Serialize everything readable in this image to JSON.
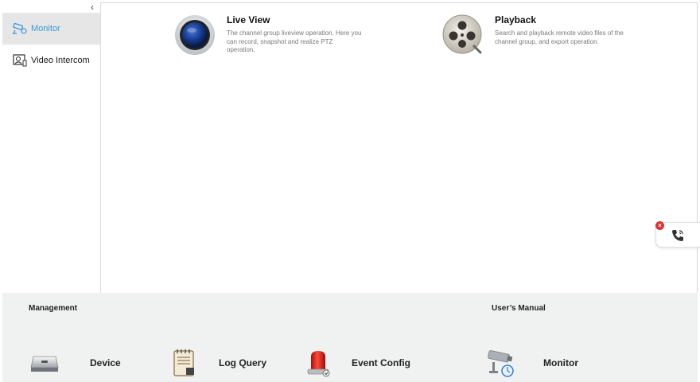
{
  "sidebar": {
    "items": [
      {
        "label": "Monitor",
        "icon": "monitor-camera-icon",
        "active": true
      },
      {
        "label": "Video Intercom",
        "icon": "video-intercom-icon",
        "active": false
      }
    ]
  },
  "modules": [
    {
      "title": "Live View",
      "description": "The channel group liveview operation. Here you can record, snapshot and realize PTZ operation.",
      "icon": "live-view-lens-icon"
    },
    {
      "title": "Playback",
      "description": "Search and playback remote video files of the channel group, and export operation.",
      "icon": "playback-reel-icon"
    }
  ],
  "bottom": {
    "management_label": "Management",
    "manual_label": "User’s Manual",
    "items": [
      {
        "label": "Device",
        "icon": "device-icon"
      },
      {
        "label": "Log Query",
        "icon": "log-query-icon"
      },
      {
        "label": "Event Config",
        "icon": "event-config-alarm-icon"
      },
      {
        "label": "Monitor",
        "icon": "monitor-camera-icon"
      }
    ]
  },
  "colors": {
    "accent": "#3a9ad9",
    "close": "#e03232",
    "bottom_bg": "#f0f1f1"
  }
}
